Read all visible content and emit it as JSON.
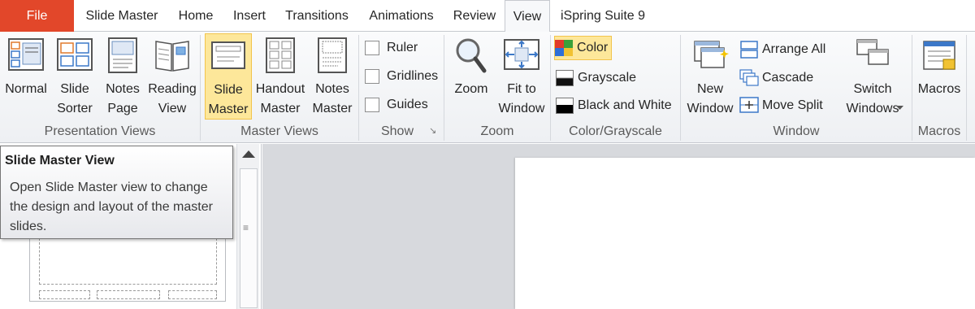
{
  "tabs": [
    {
      "label": "File",
      "id": "file"
    },
    {
      "label": "Slide Master",
      "id": "slide-master"
    },
    {
      "label": "Home",
      "id": "home"
    },
    {
      "label": "Insert",
      "id": "insert"
    },
    {
      "label": "Transitions",
      "id": "transitions"
    },
    {
      "label": "Animations",
      "id": "animations"
    },
    {
      "label": "Review",
      "id": "review"
    },
    {
      "label": "View",
      "id": "view"
    },
    {
      "label": "iSpring Suite 9",
      "id": "ispring"
    }
  ],
  "active_tab": "View",
  "groups": {
    "presentation_views": {
      "label": "Presentation Views",
      "buttons": [
        {
          "label": "Normal",
          "icon": "normal-view-icon"
        },
        {
          "label": "Slide\nSorter",
          "icon": "slide-sorter-icon"
        },
        {
          "label": "Notes\nPage",
          "icon": "notes-page-icon"
        },
        {
          "label": "Reading\nView",
          "icon": "reading-view-icon"
        }
      ]
    },
    "master_views": {
      "label": "Master Views",
      "buttons": [
        {
          "label": "Slide\nMaster",
          "icon": "slide-master-icon",
          "selected": true
        },
        {
          "label": "Handout\nMaster",
          "icon": "handout-master-icon"
        },
        {
          "label": "Notes\nMaster",
          "icon": "notes-master-icon"
        }
      ]
    },
    "show": {
      "label": "Show",
      "checkboxes": [
        {
          "label": "Ruler",
          "checked": false
        },
        {
          "label": "Gridlines",
          "checked": false
        },
        {
          "label": "Guides",
          "checked": false
        }
      ]
    },
    "zoom": {
      "label": "Zoom",
      "buttons": [
        {
          "label": "Zoom",
          "icon": "magnifier-icon"
        },
        {
          "label": "Fit to\nWindow",
          "icon": "fit-to-window-icon"
        }
      ]
    },
    "color_grayscale": {
      "label": "Color/Grayscale",
      "options": [
        {
          "label": "Color",
          "selected": true
        },
        {
          "label": "Grayscale",
          "selected": false
        },
        {
          "label": "Black and White",
          "selected": false
        }
      ]
    },
    "window": {
      "label": "Window",
      "new_window": "New\nWindow",
      "small": [
        {
          "label": "Arrange All",
          "icon": "arrange-all-icon"
        },
        {
          "label": "Cascade",
          "icon": "cascade-icon"
        },
        {
          "label": "Move Split",
          "icon": "move-split-icon"
        }
      ],
      "switch_windows": "Switch\nWindows"
    },
    "macros": {
      "label": "Macros",
      "button": "Macros"
    }
  },
  "tooltip": {
    "title": "Slide Master View",
    "body": "Open Slide Master view to change the design and layout of the master slides."
  },
  "colors": {
    "file_tab": "#e2472a",
    "highlight": "#fde79a",
    "highlight_border": "#f2c44c"
  }
}
